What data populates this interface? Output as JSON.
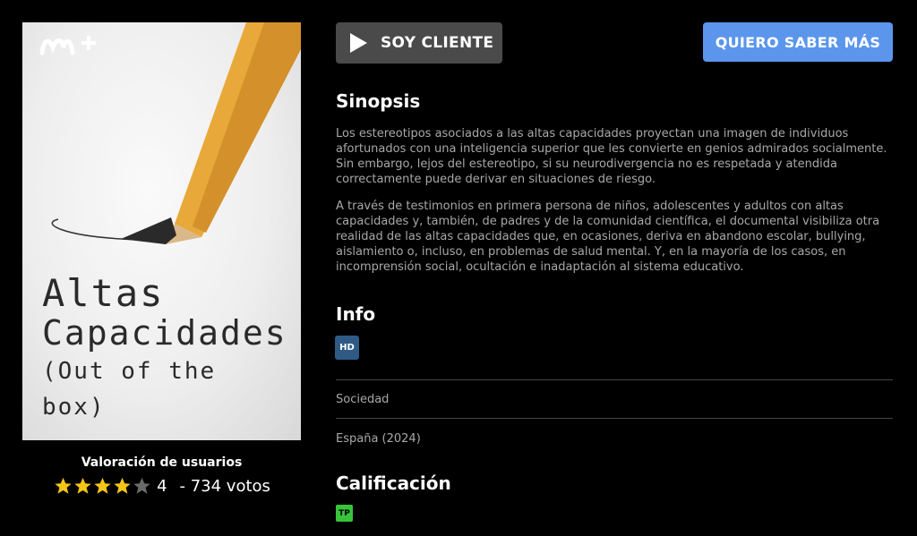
{
  "poster": {
    "brand": "M+",
    "title_line1": "Altas",
    "title_line2": "Capacidades",
    "title_line3": "(Out of the box)"
  },
  "rating": {
    "title": "Valoración de usuarios",
    "stars_filled": 4,
    "stars_total": 5,
    "score": "4",
    "votes": "- 734 votos",
    "star_color": "#f5c518"
  },
  "actions": {
    "soy_cliente": "SOY CLIENTE",
    "quiero_saber": "QUIERO SABER MÁS"
  },
  "synopsis": {
    "heading": "Sinopsis",
    "paragraph1": "Los estereotipos asociados a las altas capacidades proyectan una imagen de individuos afortunados con una inteligencia superior que les convierte en genios admirados socialmente. Sin embargo, lejos del estereotipo, si su neurodivergencia no es respetada y atendida correctamente puede derivar en situaciones de riesgo.",
    "paragraph2": "A través de testimonios en primera persona de niños, adolescentes y adultos con altas capacidades y, también, de padres y de la comunidad científica, el documental visibiliza otra realidad de las altas capacidades que, en ocasiones, deriva en abandono escolar, bullying, aislamiento o, incluso, en problemas de salud mental. Y, en la mayoría de los casos, en incomprensión social, ocultación e inadaptación al sistema educativo."
  },
  "info": {
    "heading": "Info",
    "quality_badge": "HD",
    "genre": "Sociedad",
    "country_year": "España (2024)"
  },
  "calificacion": {
    "heading": "Calificación",
    "badge": "TP",
    "badge_color": "#37c43a"
  }
}
